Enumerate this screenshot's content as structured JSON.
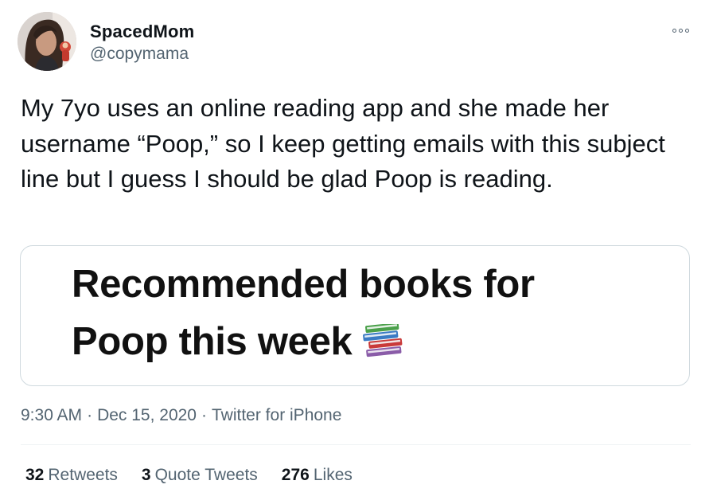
{
  "user": {
    "display_name": "SpacedMom",
    "handle": "@copymama"
  },
  "tweet": {
    "text": "My 7yo uses an online reading app and she made her username “Poop,” so I keep getting emails with this subject line but I guess I should be glad Poop is reading."
  },
  "media": {
    "line1": "Recommended books for",
    "line2": "Poop this week",
    "emoji_icon": "books-icon"
  },
  "meta": {
    "time": "9:30 AM",
    "separator": "·",
    "date": "Dec 15, 2020",
    "source": "Twitter for iPhone"
  },
  "stats": {
    "retweets_count": "32",
    "retweets_label": "Retweets",
    "quotes_count": "3",
    "quotes_label": "Quote Tweets",
    "likes_count": "276",
    "likes_label": "Likes"
  },
  "icons": {
    "more": "more-options-icon"
  },
  "colors": {
    "text_primary": "#0f1419",
    "text_secondary": "#536471",
    "border": "#cfd9de"
  }
}
